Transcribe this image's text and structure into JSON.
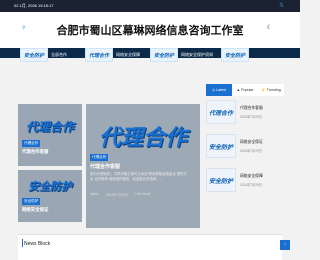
{
  "topbar": {
    "date": "02 1月, 2026 19:15:17",
    "social_icon": "twitter-icon"
  },
  "header": {
    "site_title": "合肥市蜀山区幕琳网络信息咨询工作室"
  },
  "slider": {
    "items": [
      {
        "thumb_text": "安全防护",
        "label": "全部合作"
      },
      {
        "thumb_text": "代理合作",
        "label": "网络安全保障"
      },
      {
        "thumb_text": "安全防护",
        "label": "网络安全保护须知"
      },
      {
        "thumb_text": "安全防护",
        "label": ""
      }
    ]
  },
  "left_cards": [
    {
      "art_text": "代理合作",
      "badge": "代理合作",
      "title": "代理合作客服"
    },
    {
      "art_text": "安全防护",
      "badge": "安全防护",
      "title": "网络安全保证"
    }
  ],
  "feature": {
    "art_text": "代理合作",
    "badge": "代理合作",
    "title": "代理合作客服",
    "desc": "成为代理商的，寻求拿取订单可与本站 联系获取返佣返点 提供平台 合作推荐 网络维护服务，欢迎各位来咨询……",
    "author": "admin",
    "date": "2024年7月29日",
    "read": "1 Min Read"
  },
  "tabs": [
    {
      "label": "Latest",
      "active": true
    },
    {
      "label": "Popular",
      "active": false
    },
    {
      "label": "Trending",
      "active": false
    }
  ],
  "side_list": [
    {
      "thumb_text": "代理合作",
      "title": "代理合作客服",
      "date": "2024年7月29日"
    },
    {
      "thumb_text": "安全防护",
      "title": "网络安全保证",
      "date": "2024年7月29日"
    },
    {
      "thumb_text": "安全防护",
      "title": "网络安全保障",
      "date": "2024年7月29日"
    }
  ],
  "news_block": {
    "title": "News Block"
  }
}
